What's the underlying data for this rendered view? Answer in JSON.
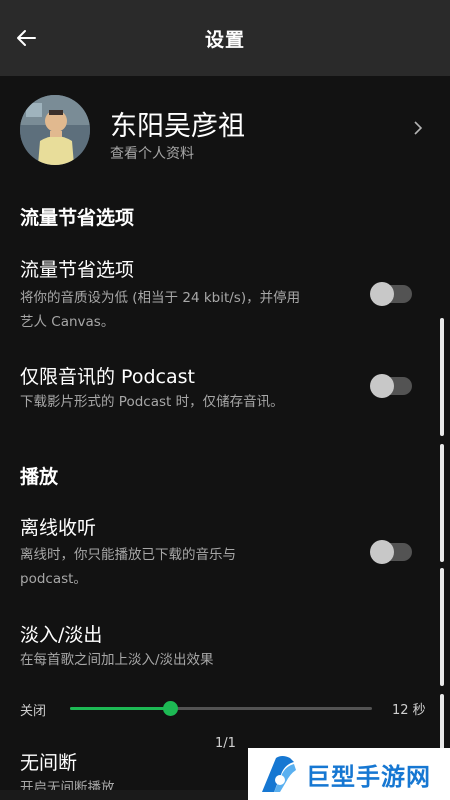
{
  "header": {
    "title": "设置"
  },
  "profile": {
    "name": "东阳吴彦祖",
    "subtitle": "查看个人资料"
  },
  "sections": {
    "data_saver": "流量节省选项",
    "playback": "播放"
  },
  "settings": {
    "data_saver": {
      "title": "流量节省选项",
      "desc_line1": "将你的音质设为低 (相当于 24 kbit/s)，并停用",
      "desc_line2": "艺人 Canvas。",
      "enabled": false
    },
    "audio_podcast": {
      "title": "仅限音讯的 Podcast",
      "desc": "下载影片形式的 Podcast 时，仅储存音讯。",
      "enabled": false
    },
    "offline": {
      "title": "离线收听",
      "desc_line1": "离线时，你只能播放已下载的音乐与",
      "desc_line2": "podcast。",
      "enabled": false
    },
    "crossfade": {
      "title": "淡入/淡出",
      "desc": "在每首歌之间加上淡入/淡出效果",
      "min_label": "关闭",
      "max_label": "12 秒",
      "value_fraction": 0.33
    },
    "gapless": {
      "title": "无间断",
      "desc": "开启无间断播放"
    }
  },
  "page_indicator": "1/1",
  "watermark": {
    "text": "巨型手游网"
  },
  "colors": {
    "accent": "#1db954",
    "background": "#121212",
    "header": "#2a2a2a"
  }
}
